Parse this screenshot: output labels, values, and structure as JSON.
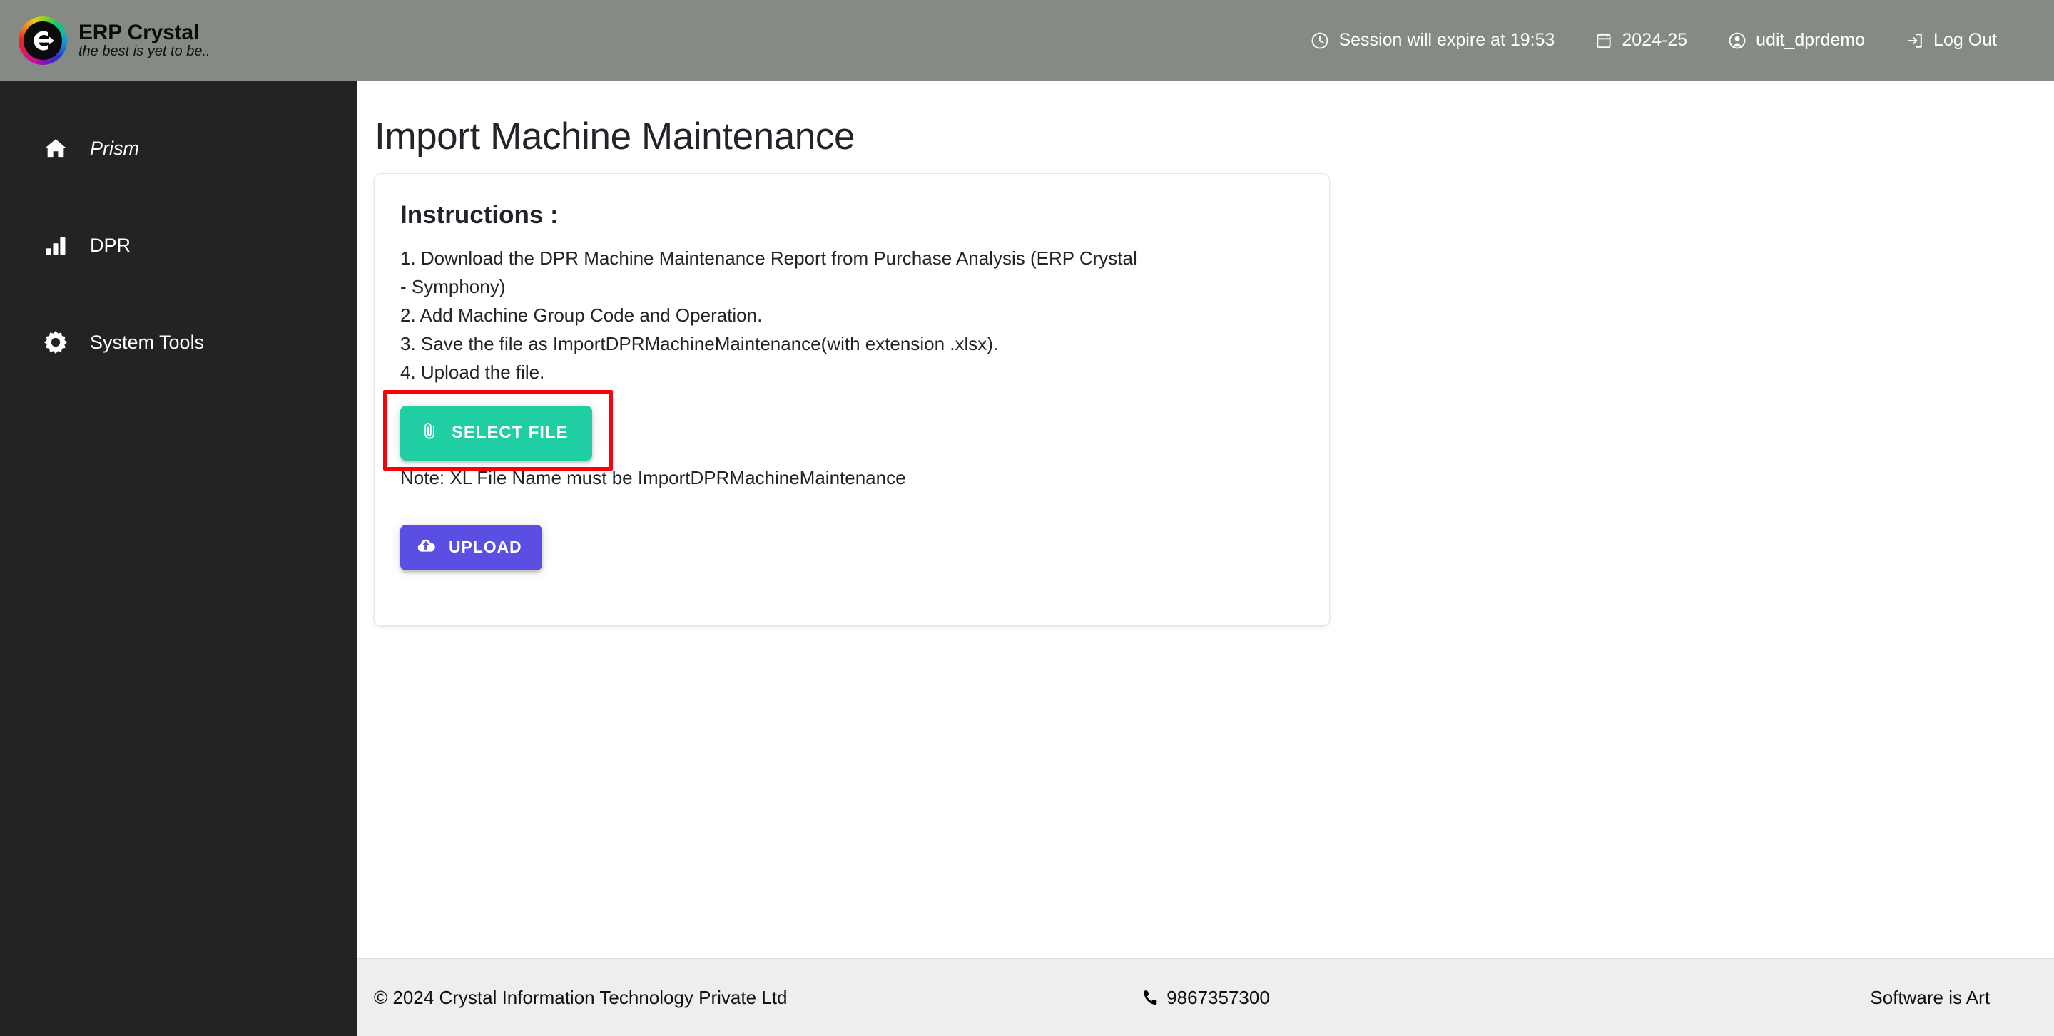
{
  "header": {
    "brand_title": "ERP Crystal",
    "brand_tagline": "the best is yet to be..",
    "logo_icon": "erp-crystal-logo",
    "items": [
      {
        "icon": "clock-icon",
        "label": "Session will expire at 19:53"
      },
      {
        "icon": "calendar-icon",
        "label": "2024-25"
      },
      {
        "icon": "user-icon",
        "label": "udit_dprdemo"
      },
      {
        "icon": "logout-icon",
        "label": "Log Out"
      }
    ]
  },
  "sidebar": {
    "items": [
      {
        "icon": "home-icon",
        "label": "Prism",
        "italic": true
      },
      {
        "icon": "bar-chart-icon",
        "label": "DPR",
        "italic": false
      },
      {
        "icon": "gear-icon",
        "label": "System Tools",
        "italic": false
      }
    ]
  },
  "main": {
    "page_title": "Import Machine Maintenance",
    "card": {
      "instructions_heading": "Instructions :",
      "instructions": [
        "1. Download the DPR Machine Maintenance Report from Purchase Analysis (ERP Crystal",
        "- Symphony)",
        "2. Add Machine Group Code and Operation.",
        "3. Save the file as ImportDPRMachineMaintenance(with extension .xlsx).",
        "4. Upload the file."
      ],
      "select_file_label": "SELECT FILE",
      "select_file_icon": "paperclip-icon",
      "note": "Note: XL File Name must be ImportDPRMachineMaintenance",
      "upload_label": "UPLOAD",
      "upload_icon": "cloud-upload-icon"
    }
  },
  "footer": {
    "copyright": "© 2024 Crystal Information Technology Private Ltd",
    "phone_icon": "phone-icon",
    "phone": "9867357300",
    "tagline": "Software is Art"
  },
  "colors": {
    "header_bg": "#858a85",
    "sidebar_bg": "#232326",
    "select_file_btn": "#1fcfa3",
    "upload_btn": "#5a4fe2",
    "highlight_border": "#fb0007",
    "footer_bg": "#eeeeec",
    "text_dark": "#212529"
  }
}
